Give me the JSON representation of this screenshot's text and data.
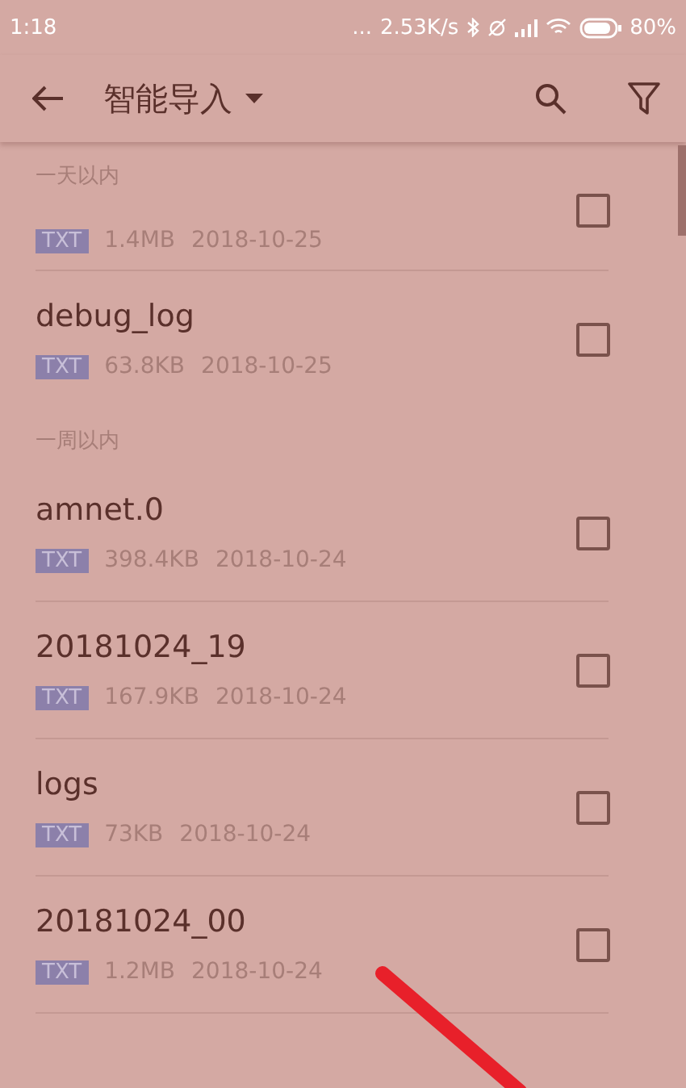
{
  "status_bar": {
    "time": "1:18",
    "dots": "...",
    "speed": "2.53K/s",
    "battery": "80%"
  },
  "toolbar": {
    "title": "智能导入"
  },
  "sections": [
    {
      "header": "一天以内",
      "files": [
        {
          "type": "TXT",
          "size": "1.4MB",
          "date": "2018-10-25",
          "checked": false
        },
        {
          "name": "debug_log",
          "type": "TXT",
          "size": "63.8KB",
          "date": "2018-10-25",
          "checked": false
        }
      ]
    },
    {
      "header": "一周以内",
      "files": [
        {
          "name": "amnet.0",
          "type": "TXT",
          "size": "398.4KB",
          "date": "2018-10-24",
          "checked": false
        },
        {
          "name": "20181024_19",
          "type": "TXT",
          "size": "167.9KB",
          "date": "2018-10-24",
          "checked": false
        },
        {
          "name": "logs",
          "type": "TXT",
          "size": "73KB",
          "date": "2018-10-24",
          "checked": false
        },
        {
          "name": "20181024_00",
          "type": "TXT",
          "size": "1.2MB",
          "date": "2018-10-24",
          "checked": false
        }
      ]
    }
  ]
}
